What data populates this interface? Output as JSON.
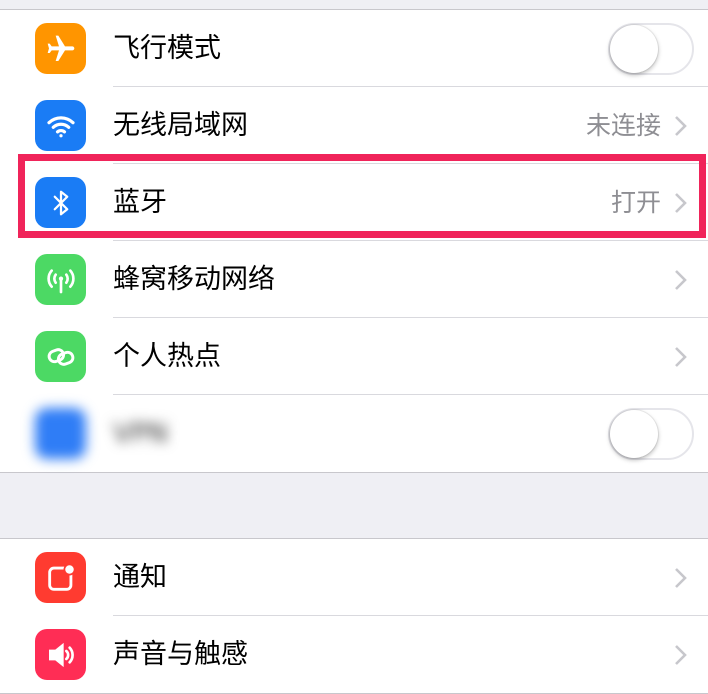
{
  "group1": {
    "items": [
      {
        "label": "飞行模式",
        "icon": "airplane-icon",
        "icon_color": "#ff9500",
        "control": "toggle",
        "toggle_on": false
      },
      {
        "label": "无线局域网",
        "icon": "wifi-icon",
        "icon_color": "#1a7cf5",
        "detail": "未连接",
        "control": "chevron"
      },
      {
        "label": "蓝牙",
        "icon": "bluetooth-icon",
        "icon_color": "#1a7cf5",
        "detail": "打开",
        "control": "chevron"
      },
      {
        "label": "蜂窝移动网络",
        "icon": "cellular-icon",
        "icon_color": "#4cd964",
        "control": "chevron"
      },
      {
        "label": "个人热点",
        "icon": "hotspot-icon",
        "icon_color": "#4cd964",
        "control": "chevron"
      },
      {
        "label": "VPN",
        "icon": "vpn-icon",
        "icon_color": "#2f7df6",
        "control": "toggle",
        "toggle_on": false
      }
    ]
  },
  "group2": {
    "items": [
      {
        "label": "通知",
        "icon": "notifications-icon",
        "icon_color": "#ff3b30",
        "control": "chevron"
      },
      {
        "label": "声音与触感",
        "icon": "sound-icon",
        "icon_color": "#ff2d55",
        "control": "chevron"
      }
    ]
  },
  "highlight_color": "#f0245a"
}
